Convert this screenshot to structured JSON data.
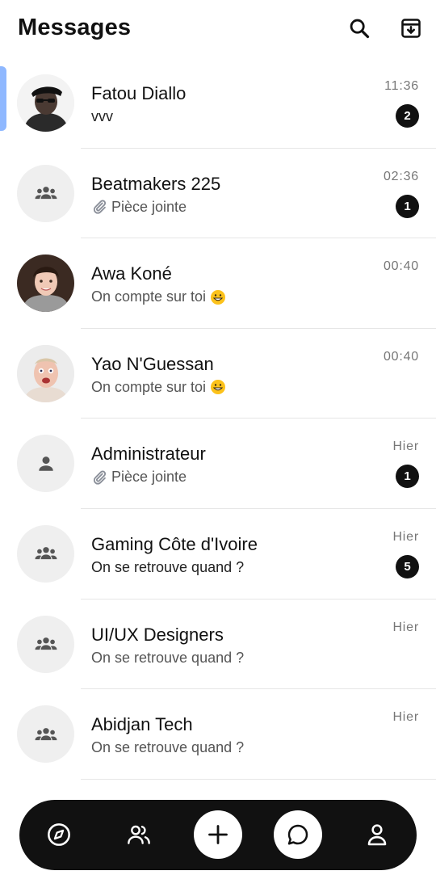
{
  "header": {
    "title": "Messages",
    "icons": [
      "search-icon",
      "archive-icon"
    ]
  },
  "conversations": [
    {
      "name": "Fatou Diallo",
      "preview": "vvv",
      "time": "11:36",
      "unread": "2",
      "avatar": "photo",
      "active": true
    },
    {
      "name": "Beatmakers 225",
      "preview": "Pièce jointe",
      "preview_icon": "paperclip-icon",
      "time": "02:36",
      "unread": "1",
      "avatar": "group-icon"
    },
    {
      "name": "Awa Koné",
      "preview": "On compte sur toi",
      "preview_emoji": "grinning-emoji",
      "time": "00:40",
      "avatar": "photo"
    },
    {
      "name": "Yao N'Guessan",
      "preview": "On compte sur toi",
      "preview_emoji": "grinning-emoji",
      "time": "00:40",
      "avatar": "photo"
    },
    {
      "name": "Administrateur",
      "preview": "Pièce jointe",
      "preview_icon": "paperclip-icon",
      "time": "Hier",
      "unread": "1",
      "avatar": "person-icon"
    },
    {
      "name": "Gaming Côte d'Ivoire",
      "preview": "On se retrouve quand ?",
      "time": "Hier",
      "unread": "5",
      "avatar": "group-icon"
    },
    {
      "name": "UI/UX Designers",
      "preview": "On se retrouve quand ?",
      "time": "Hier",
      "avatar": "group-icon"
    },
    {
      "name": "Abidjan Tech",
      "preview": "On se retrouve quand ?",
      "time": "Hier",
      "avatar": "group-icon"
    }
  ],
  "bottom_nav": {
    "items": [
      "compass-icon",
      "people-icon",
      "plus-icon",
      "chat-icon",
      "profile-icon"
    ]
  },
  "colors": {
    "accent_bar": "#8fb8ff",
    "badge_bg": "#111111",
    "nav_bg": "#111111"
  }
}
